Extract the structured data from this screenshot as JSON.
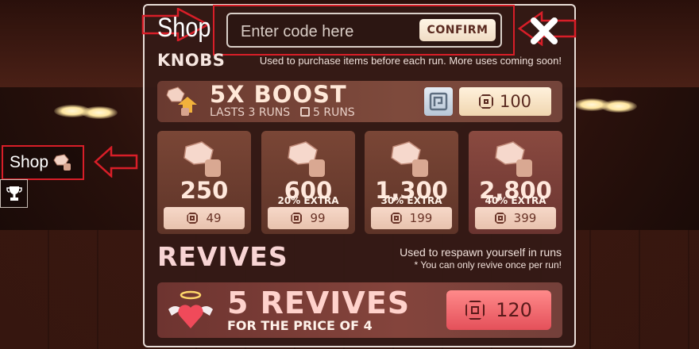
{
  "sidebar": {
    "shop_label": "Shop"
  },
  "header": {
    "title": "Shop",
    "code_placeholder": "Enter code here",
    "confirm_label": "CONFIRM"
  },
  "knobs": {
    "title": "KNOBS",
    "description": "Used to purchase items before each run. More uses coming soon!",
    "boost": {
      "title": "5X BOOST",
      "subtitle": "LASTS 3 RUNS",
      "runs_label": "5 RUNS",
      "price": "100"
    },
    "packs": [
      {
        "amount": "250",
        "extra": "",
        "price": "49"
      },
      {
        "amount": "600",
        "extra": "20% EXTRA",
        "price": "99"
      },
      {
        "amount": "1,300",
        "extra": "30% EXTRA",
        "price": "199"
      },
      {
        "amount": "2,800",
        "extra": "40% EXTRA",
        "price": "399"
      }
    ]
  },
  "revives": {
    "title": "REVIVES",
    "description_line1": "Used to respawn yourself in runs",
    "description_line2": "* You can only revive once per run!",
    "offer": {
      "title": "5 REVIVES",
      "subtitle": "FOR THE PRICE OF 4",
      "price": "120"
    }
  },
  "colors": {
    "highlight_outline": "#d81e28",
    "panel_bg": "#341a16",
    "accent_price": "#e4505a"
  },
  "icons": [
    "knob-icon",
    "trophy-icon",
    "close-icon",
    "robux-icon",
    "boost-icon",
    "pass-icon",
    "winged-heart-icon"
  ]
}
